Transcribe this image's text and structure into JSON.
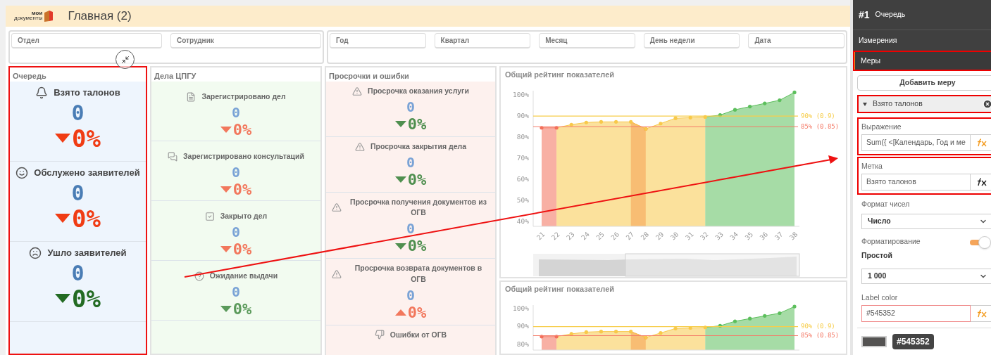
{
  "header": {
    "logo_top": "мои",
    "logo_bottom": "документы",
    "title": "Главная (2)"
  },
  "filter_groups": [
    {
      "filters": [
        {
          "label": "Отдел"
        },
        {
          "label": "Сотрудник"
        }
      ]
    },
    {
      "filters": [
        {
          "label": "Год"
        },
        {
          "label": "Квартал"
        },
        {
          "label": "Месяц"
        },
        {
          "label": "День недели"
        },
        {
          "label": "Дата"
        }
      ]
    }
  ],
  "kpi_panels": [
    {
      "title": "Очередь",
      "highlighted": true,
      "items": [
        {
          "label": "Взято талонов",
          "value": "0",
          "change": "0%",
          "rising": false,
          "color": "#f03c14"
        },
        {
          "label": "Обслужено заявителей",
          "value": "0",
          "change": "0%",
          "rising": false,
          "color": "#f03c14"
        },
        {
          "label": "Ушло заявителей",
          "value": "0",
          "change": "0%",
          "rising": false,
          "color": "#236b23"
        }
      ]
    },
    {
      "title": "Дела ЦПГУ",
      "highlighted": false,
      "items": [
        {
          "label": "Зарегистрировано дел",
          "value": "0",
          "change": "0%",
          "rising": false,
          "color": "#f2775c"
        },
        {
          "label": "Зарегистрировано консультаций",
          "value": "0",
          "change": "0%",
          "rising": false,
          "color": "#f2775c"
        },
        {
          "label": "Закрыто дел",
          "value": "0",
          "change": "0%",
          "rising": false,
          "color": "#f2775c"
        },
        {
          "label": "Ожидание выдачи",
          "value": "0",
          "change": "0%",
          "rising": false,
          "color": "#5b9a5b"
        }
      ]
    },
    {
      "title": "Просрочки и ошибки",
      "highlighted": false,
      "items": [
        {
          "label": "Просрочка оказания услуги",
          "value": "0",
          "change": "0%",
          "rising": false,
          "color": "#4f8f4f"
        },
        {
          "label": "Просрочка закрытия дела",
          "value": "0",
          "change": "0%",
          "rising": false,
          "color": "#4f8f4f"
        },
        {
          "label": "Просрочка получения документов из ОГВ",
          "value": "0",
          "change": "0%",
          "rising": false,
          "color": "#4f8f4f"
        },
        {
          "label": "Просрочка возврата документов в ОГВ",
          "value": "0",
          "change": "0%",
          "rising": true,
          "color": "#f2775c"
        },
        {
          "label": "Ошибки от ОГВ"
        }
      ]
    }
  ],
  "charts": [
    {
      "title": "Общий рейтинг показателей",
      "navigator": true,
      "chart_data": {
        "type": "area",
        "categories": [
          "21",
          "22",
          "23",
          "24",
          "25",
          "26",
          "27",
          "28",
          "29",
          "30",
          "31",
          "32",
          "33",
          "34",
          "35",
          "36",
          "37",
          "38"
        ],
        "series": [
          {
            "color": "#f36f5a",
            "values": [
              84.5,
              84.5,
              null,
              null,
              null,
              null,
              87.3,
              84,
              null,
              null,
              null,
              null,
              null,
              null,
              null,
              null,
              null,
              null
            ]
          },
          {
            "color": "#f8c94a",
            "values": [
              null,
              84.5,
              86,
              87,
              87.3,
              87.3,
              87.3,
              84,
              86.5,
              89,
              89.3,
              89.6,
              null,
              null,
              null,
              null,
              null,
              null
            ]
          },
          {
            "color": "#5cbf5c",
            "values": [
              null,
              null,
              null,
              null,
              null,
              null,
              null,
              null,
              null,
              null,
              null,
              89.6,
              90.5,
              93,
              94.5,
              96,
              97.5,
              101.2
            ]
          }
        ],
        "ylim": [
          38,
          102
        ],
        "yticks": [
          {
            "value": 40,
            "label": "40%"
          },
          {
            "value": 50,
            "label": "50%"
          },
          {
            "value": 60,
            "label": "60%"
          },
          {
            "value": 70,
            "label": "70%"
          },
          {
            "value": 80,
            "label": "80%"
          },
          {
            "value": 90,
            "label": "90%"
          },
          {
            "value": 100,
            "label": "100%"
          }
        ],
        "ref_lines": [
          {
            "axis": "y",
            "value": 90,
            "label": "90% (0.9)",
            "color": "#f7cd4a"
          },
          {
            "axis": "y",
            "value": 85,
            "label": "85% (0.85)",
            "color": "#f47b68"
          }
        ]
      }
    },
    {
      "title": "Общий рейтинг показателей",
      "navigator": false,
      "chart_data": {
        "type": "area",
        "series": [
          {
            "color": "#f36f5a",
            "values": [
              84.5,
              84.5,
              null,
              null,
              null,
              null,
              87.3,
              84,
              null,
              null,
              null,
              null,
              null,
              null,
              null,
              null,
              null,
              null
            ]
          },
          {
            "color": "#f8c94a",
            "values": [
              null,
              84.5,
              86,
              87,
              87.3,
              87.3,
              87.3,
              84,
              86.5,
              89,
              89.3,
              89.6,
              null,
              null,
              null,
              null,
              null,
              null
            ]
          },
          {
            "color": "#5cbf5c",
            "values": [
              null,
              null,
              null,
              null,
              null,
              null,
              null,
              null,
              null,
              null,
              null,
              89.6,
              90.5,
              93,
              94.5,
              96,
              97.5,
              101.2
            ]
          }
        ],
        "ylim": [
          77,
          102
        ],
        "yticks": [
          {
            "value": 80,
            "label": "80%"
          },
          {
            "value": 90,
            "label": "90%"
          },
          {
            "value": 100,
            "label": "100%"
          }
        ],
        "ref_lines": [
          {
            "axis": "y",
            "value": 90,
            "label": "90% (0.9)",
            "color": "#f7cd4a"
          },
          {
            "axis": "y",
            "value": 85,
            "label": "85% (0.85)",
            "color": "#f47b68"
          }
        ]
      }
    }
  ],
  "properties": {
    "number": "#1",
    "name": "Очередь",
    "sections": [
      {
        "label": "Измерения",
        "selected": false,
        "highlighted": false
      },
      {
        "label": "Меры",
        "selected": true,
        "highlighted": true
      }
    ],
    "add_button": "Добавить меру",
    "measure": {
      "title": "Взято талонов",
      "expanded": true,
      "highlighted": true
    },
    "fields": [
      {
        "kind": "input",
        "label": "Выражение",
        "value": "Sum({ <[Календарь, Год и ме",
        "fx_active": true,
        "highlighted": true,
        "error": false
      },
      {
        "kind": "input",
        "label": "Метка",
        "value": "Взято талонов",
        "fx_active": false,
        "highlighted": true,
        "error": false
      },
      {
        "kind": "select",
        "label": "Формат чисел",
        "value": "Число"
      },
      {
        "kind": "toggle",
        "label": "Форматирование",
        "on": true,
        "value": "Простой"
      },
      {
        "kind": "select",
        "value": "1 000"
      },
      {
        "kind": "input",
        "label": "Label color",
        "value": "#545352",
        "fx_active": true,
        "error": true
      },
      {
        "kind": "swatch",
        "color": "#545352",
        "tooltip": "#545352"
      }
    ]
  },
  "annotation_arrow": true
}
